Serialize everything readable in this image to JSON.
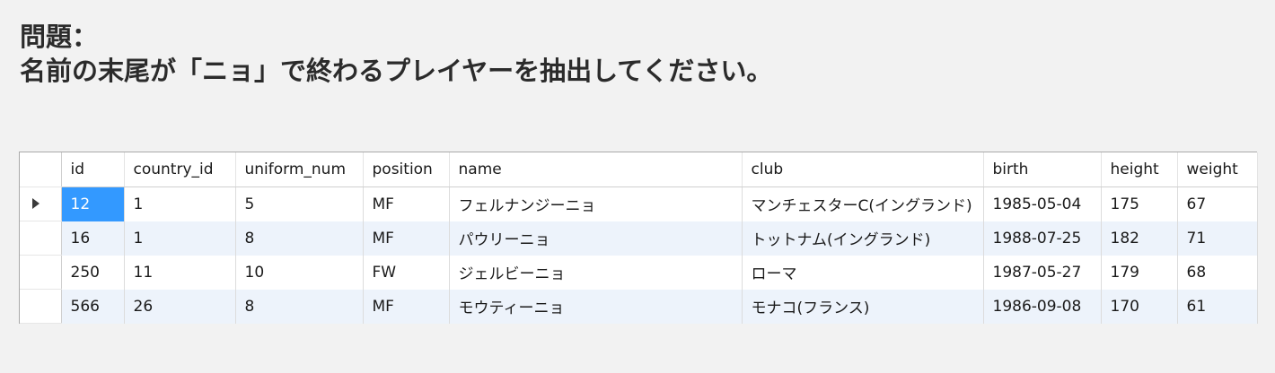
{
  "question": {
    "label": "問題：",
    "text": "名前の末尾が「ニョ」で終わるプレイヤーを抽出してください。"
  },
  "table": {
    "columns": [
      "id",
      "country_id",
      "uniform_num",
      "position",
      "name",
      "club",
      "birth",
      "height",
      "weight"
    ],
    "rows": [
      [
        "12",
        "1",
        "5",
        "MF",
        "フェルナンジーニョ",
        "マンチェスターC(イングランド)",
        "1985-05-04",
        "175",
        "67"
      ],
      [
        "16",
        "1",
        "8",
        "MF",
        "パウリーニョ",
        "トットナム(イングランド)",
        "1988-07-25",
        "182",
        "71"
      ],
      [
        "250",
        "11",
        "10",
        "FW",
        "ジェルビーニョ",
        "ローマ",
        "1987-05-27",
        "179",
        "68"
      ],
      [
        "566",
        "26",
        "8",
        "MF",
        "モウティーニョ",
        "モナコ(フランス)",
        "1986-09-08",
        "170",
        "61"
      ]
    ],
    "current_row_index": 0,
    "selected_cell": "id",
    "colors": {
      "selected_cell_bg": "#3399ff",
      "alt_row_bg": "#edf3fb"
    }
  }
}
